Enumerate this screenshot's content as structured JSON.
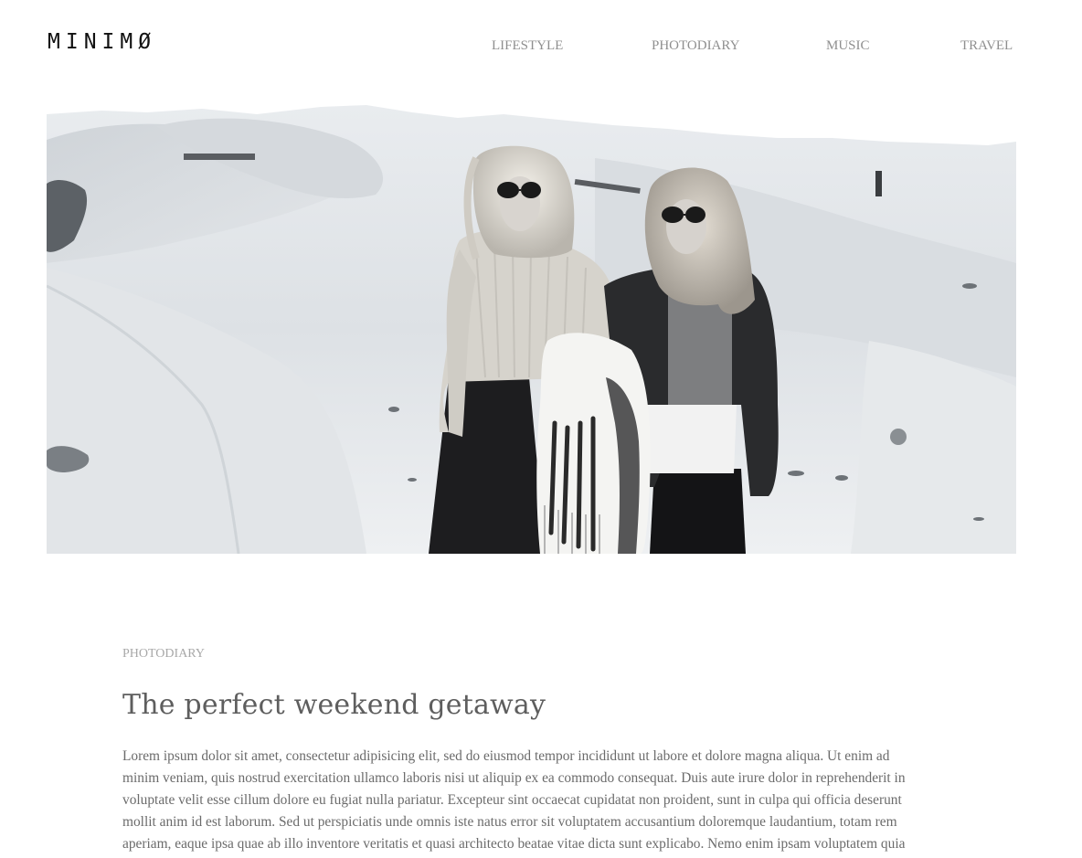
{
  "header": {
    "logo": "MINIMØ",
    "nav": [
      {
        "label": "LIFESTYLE"
      },
      {
        "label": "PHOTODIARY"
      },
      {
        "label": "MUSIC"
      },
      {
        "label": "TRAVEL"
      }
    ]
  },
  "hero": {
    "image_alt": ""
  },
  "article": {
    "category": "PHOTODIARY",
    "title": "The perfect weekend getaway",
    "body": "Lorem ipsum dolor sit amet, consectetur adipisicing elit, sed do eiusmod tempor incididunt ut labore et dolore magna aliqua. Ut enim ad minim veniam, quis nostrud exercitation ullamco laboris nisi ut aliquip ex ea commodo consequat. Duis aute irure dolor in reprehenderit in voluptate velit esse cillum dolore eu fugiat nulla pariatur. Excepteur sint occaecat cupidatat non proident, sunt in culpa qui officia deserunt mollit anim id est laborum. Sed ut perspiciatis unde omnis iste natus error sit voluptatem accusantium doloremque laudantium, totam rem aperiam, eaque ipsa quae ab illo inventore veritatis et quasi architecto beatae vitae dicta sunt explicabo. Nemo enim ipsam voluptatem quia"
  }
}
